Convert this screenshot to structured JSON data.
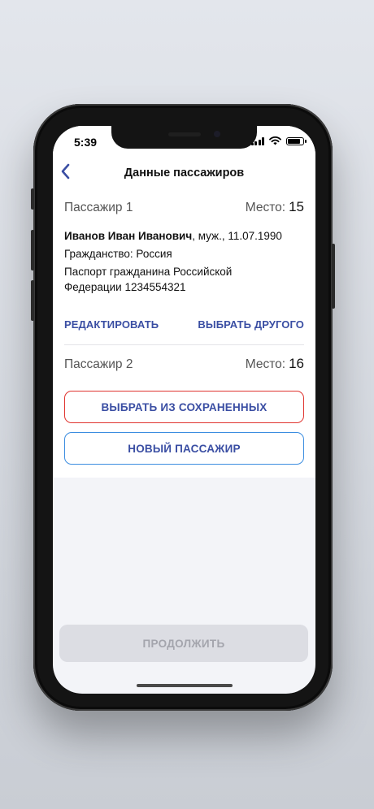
{
  "status_bar": {
    "time": "5:39"
  },
  "header": {
    "title": "Данные пассажиров",
    "back_icon": "chevron-left-icon"
  },
  "passenger1": {
    "label": "Пассажир 1",
    "seat_label": "Место:",
    "seat_value": "15",
    "name": "Иванов Иван Иванович",
    "details": ", муж., 11.07.1990",
    "citizenship": "Гражданство: Россия",
    "document_line1": "Паспорт гражданина Российской",
    "document_line2": "Федерации 1234554321",
    "edit_label": "РЕДАКТИРОВАТЬ",
    "choose_other_label": "ВЫБРАТЬ ДРУГОГО"
  },
  "passenger2": {
    "label": "Пассажир 2",
    "seat_label": "Место:",
    "seat_value": "16",
    "choose_saved_label": "ВЫБРАТЬ ИЗ СОХРАНЕННЫХ",
    "new_passenger_label": "НОВЫЙ ПАССАЖИР"
  },
  "footer": {
    "continue_label": "ПРОДОЛЖИТЬ"
  },
  "colors": {
    "accent": "#3a4ea3",
    "danger_border": "#e0342f",
    "info_border": "#3b8de0",
    "disabled_bg": "#dcdde3",
    "disabled_text": "#a4a5ad"
  }
}
